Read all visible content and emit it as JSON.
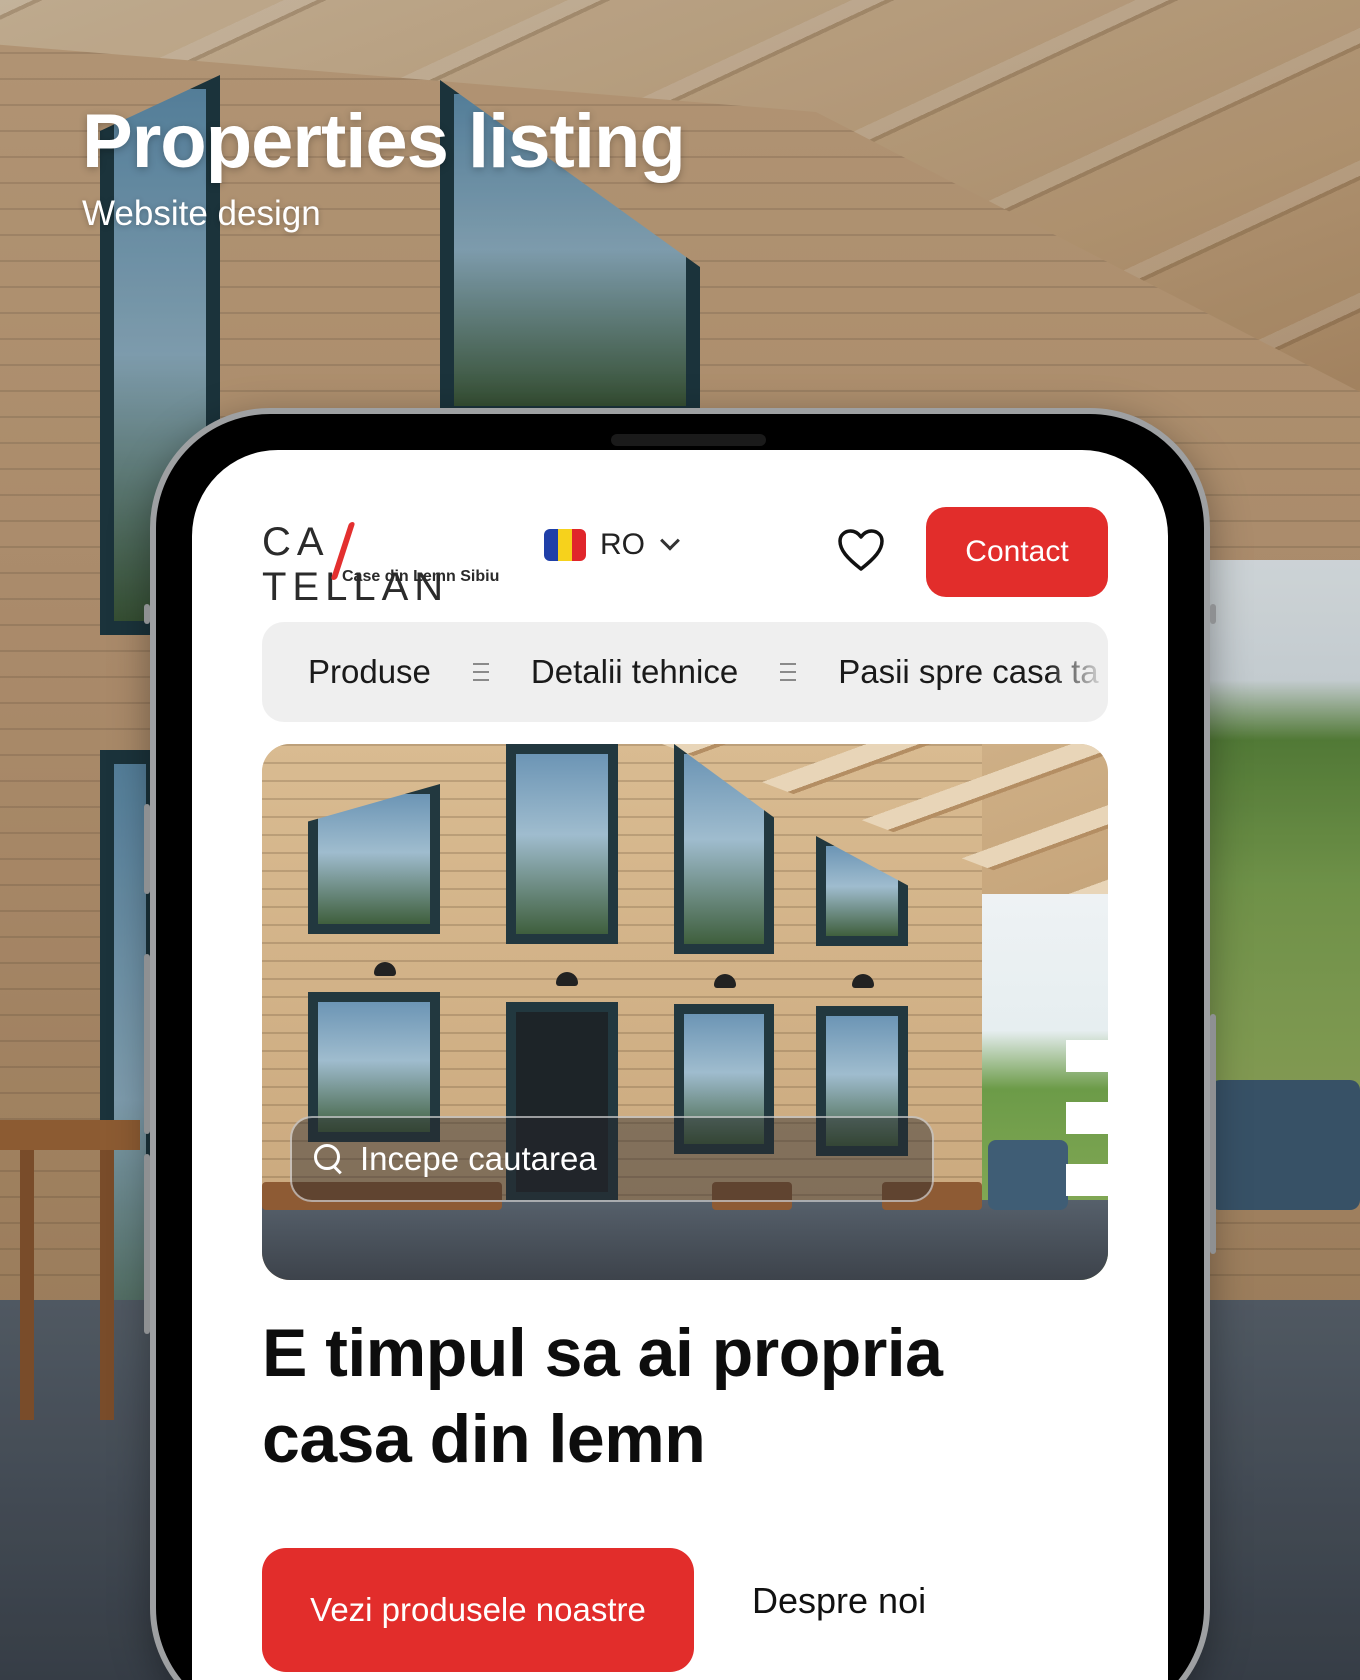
{
  "showcase": {
    "title": "Properties listing",
    "subtitle": "Website design"
  },
  "header": {
    "logo_text": "CA TELLAN",
    "logo_tagline": "Case din Lemn Sibiu",
    "language_code": "RO",
    "flag_colors": [
      "#1f3fa8",
      "#f6d21c",
      "#e0262b"
    ],
    "contact_label": "Contact"
  },
  "nav": {
    "items": [
      {
        "label": "Produse"
      },
      {
        "label": "Detalii tehnice"
      },
      {
        "label": "Pasii spre casa ta"
      }
    ]
  },
  "hero": {
    "search_placeholder": "Incepe cautarea",
    "headline": "E timpul sa ai propria casa din lemn",
    "primary_cta": "Vezi produsele noastre",
    "secondary_cta": "Despre noi"
  },
  "theme": {
    "accent": "#e22d2b"
  }
}
